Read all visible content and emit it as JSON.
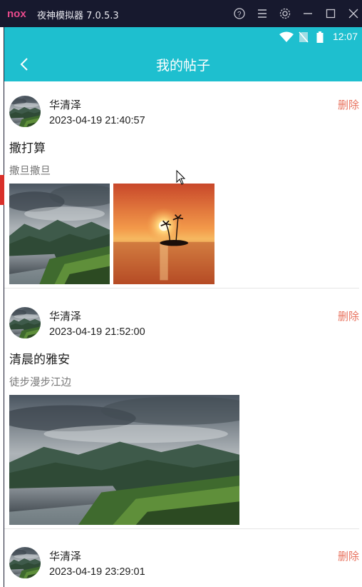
{
  "emulator": {
    "title": "夜神模拟器 7.0.5.3",
    "controls": [
      "help-icon",
      "menu-icon",
      "settings-icon",
      "minimize-icon",
      "maximize-icon",
      "close-icon"
    ]
  },
  "status_bar": {
    "time": "12:07",
    "icons": [
      "wifi-icon",
      "no-sim-icon",
      "battery-icon"
    ]
  },
  "header": {
    "title": "我的帖子",
    "back_icon": "back-arrow-icon"
  },
  "colors": {
    "accent": "#1ebfcf",
    "delete": "#e8725e",
    "emulator_bar": "#17192e"
  },
  "posts": [
    {
      "author": "华清泽",
      "time": "2023-04-19 21:40:57",
      "delete_label": "删除",
      "title": "撒打算",
      "body": "撒旦撒旦",
      "images": [
        "lake-landscape",
        "sunset-island"
      ]
    },
    {
      "author": "华清泽",
      "time": "2023-04-19 21:52:00",
      "delete_label": "删除",
      "title": "清晨的雅安",
      "body": "徒步漫步江边",
      "images": [
        "lake-landscape"
      ]
    },
    {
      "author": "华清泽",
      "time": "2023-04-19 23:29:01",
      "delete_label": "删除",
      "title": "",
      "body": "",
      "images": []
    }
  ]
}
